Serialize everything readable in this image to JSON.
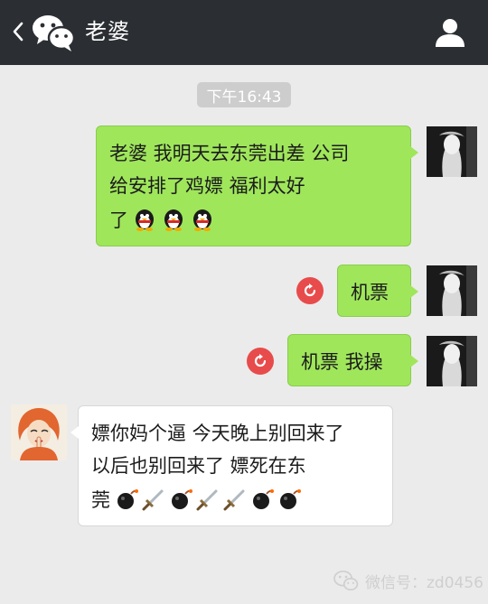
{
  "header": {
    "title": "老婆",
    "back_icon": "chevron-left-icon",
    "app_icon": "wechat-logo-icon",
    "profile_icon": "person-icon"
  },
  "timestamp": "下午16:43",
  "messages": [
    {
      "direction": "out",
      "lines": [
        "老婆 我明天去东莞出差 公司",
        "给安排了鸡嫖 福利太好",
        "了"
      ],
      "emojis": [
        "penguin-emoji",
        "penguin-emoji",
        "penguin-emoji"
      ]
    },
    {
      "direction": "out",
      "text": "机票",
      "status": "failed-resend"
    },
    {
      "direction": "out",
      "text": "机票 我操",
      "status": "failed-resend"
    },
    {
      "direction": "in",
      "lines": [
        "嫖你妈个逼 今天晚上别回来了",
        "以后也别回来了 嫖死在东",
        "莞"
      ],
      "emojis": [
        "bomb-emoji",
        "dagger-emoji",
        "bomb-emoji",
        "dagger-emoji",
        "dagger-emoji",
        "bomb-emoji",
        "bomb-emoji"
      ]
    }
  ],
  "watermark": {
    "label": "微信号：zd0456",
    "icon": "wechat-logo-icon"
  },
  "colors": {
    "header_bg": "#2b2f33",
    "chat_bg": "#ebebeb",
    "outgoing_bubble": "#9fe65b",
    "incoming_bubble": "#ffffff",
    "resend_badge": "#e84b4b"
  }
}
